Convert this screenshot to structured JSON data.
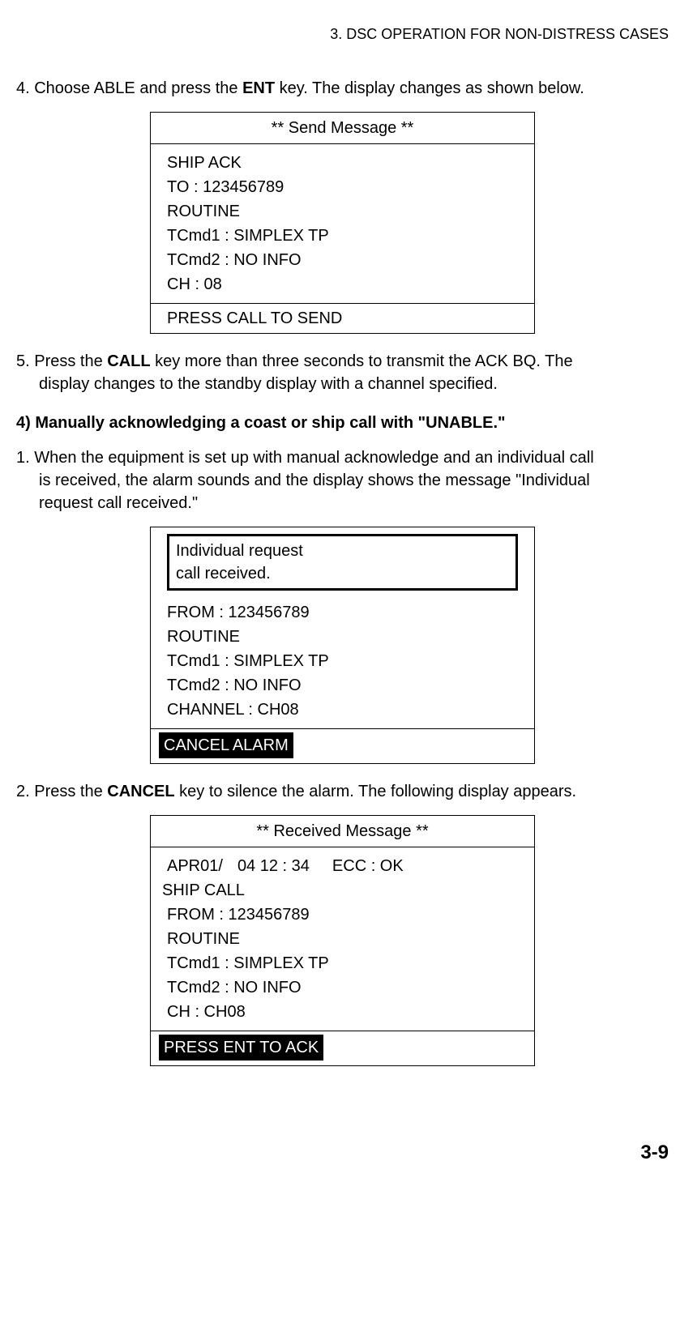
{
  "header": "3. DSC OPERATION FOR NON-DISTRESS CASES",
  "step4": {
    "prefix": "4. Choose ABLE and press the ",
    "bold": "ENT",
    "suffix": " key. The display changes as shown below."
  },
  "display1": {
    "title": "** Send Message **",
    "lines": {
      "l1": "SHIP ACK",
      "l2": "TO : 123456789",
      "l3": "ROUTINE",
      "l4": "TCmd1 : SIMPLEX TP",
      "l5": "TCmd2 : NO INFO",
      "l6": "CH : 08"
    },
    "footer": "PRESS CALL TO SEND"
  },
  "step5": {
    "prefix": "5. Press the ",
    "bold": "CALL",
    "suffix1": " key more than three seconds to transmit the ACK BQ. The",
    "line2": "display changes to the standby display with a channel specified."
  },
  "section_heading": "4) Manually acknowledging a coast or ship call with \"UNABLE.\"",
  "step1b": {
    "line1": "1. When the equipment is set up with manual acknowledge and an individual call",
    "line2": "is received, the alarm sounds and the display shows the message \"Individual",
    "line3": "request call received.\""
  },
  "display2": {
    "notice_l1": "Individual request",
    "notice_l2": "call received.",
    "lines": {
      "l1": "FROM : 123456789",
      "l2": "ROUTINE",
      "l3": "TCmd1 : SIMPLEX TP",
      "l4": "TCmd2 : NO INFO",
      "l5": "CHANNEL : CH08"
    },
    "footer": "CANCEL ALARM"
  },
  "step2b": {
    "prefix": "2. Press the ",
    "bold": "CANCEL",
    "suffix": " key to silence the alarm. The following display appears."
  },
  "display3": {
    "title": "** Received Message **",
    "timestamp_a": "APR01/",
    "timestamp_b": "04 12 : 34",
    "timestamp_c": "ECC : OK",
    "lines": {
      "l1": "SHIP CALL",
      "l2": "FROM : 123456789",
      "l3": "ROUTINE",
      "l4": "TCmd1 : SIMPLEX TP",
      "l5": "TCmd2 : NO INFO",
      "l6": "CH : CH08"
    },
    "footer": "PRESS ENT TO ACK"
  },
  "page_number": "3-9"
}
